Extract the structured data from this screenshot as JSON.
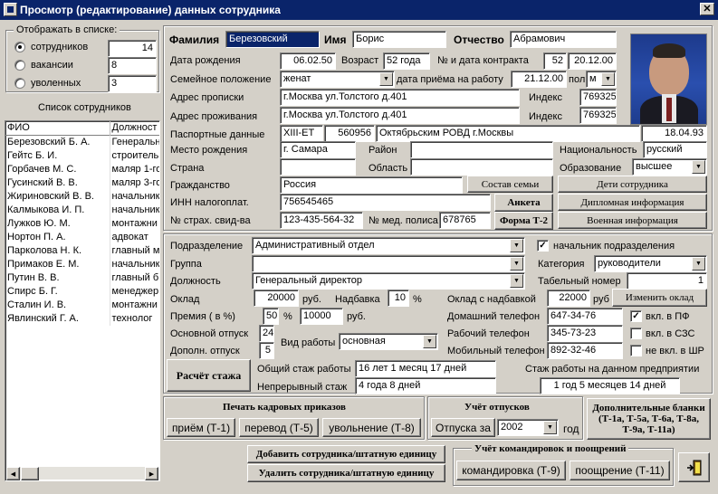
{
  "window": {
    "title": "Просмотр (редактирование) данных сотрудника",
    "close": "✕"
  },
  "left": {
    "show_title": "Отображать в списке:",
    "radios": [
      {
        "label": "сотрудников",
        "count": "14"
      },
      {
        "label": "вакансии",
        "count": "8"
      },
      {
        "label": "уволенных",
        "count": "3"
      }
    ],
    "list_title": "Список сотрудников",
    "columns": [
      "ФИО",
      "Должност"
    ],
    "rows": [
      [
        "Березовский Б. А.",
        "Генеральн"
      ],
      [
        "Гейтс Б. И.",
        "строитель"
      ],
      [
        "Горбачев М. С.",
        "маляр 1-го"
      ],
      [
        "Гусинский В. В.",
        "маляр 3-го"
      ],
      [
        "Жириновский В. В.",
        "начальник"
      ],
      [
        "Калмыкова И. П.",
        "начальник"
      ],
      [
        "Лужков Ю. М.",
        "монтажни"
      ],
      [
        "Нортон П. А.",
        "адвокат"
      ],
      [
        "Парколова Н. К.",
        "главный м"
      ],
      [
        "Примаков Е. М.",
        "начальник"
      ],
      [
        "Путин В. В.",
        "главный б"
      ],
      [
        "Спирс Б. Г.",
        "менеджер"
      ],
      [
        "Сталин И. В.",
        "монтажни"
      ],
      [
        "Явлинский Г. А.",
        "технолог"
      ]
    ]
  },
  "person": {
    "surname_label": "Фамилия",
    "surname": "Березовский",
    "name_label": "Имя",
    "name": "Борис",
    "patronymic_label": "Отчество",
    "patronymic": "Абрамович",
    "birth_label": "Дата рождения",
    "birth": "06.02.50",
    "age_label": "Возраст",
    "age": "52 года",
    "contract_label": "№ и дата контракта",
    "contract_no": "52",
    "contract_date": "20.12.00",
    "family_label": "Семейное положение",
    "family": "женат",
    "hire_label": "дата приёма на работу",
    "hire": "21.12.00",
    "sex_label": "пол",
    "sex": "м",
    "reg_label": "Адрес прописки",
    "reg": "г.Москва ул.Толстого д.401",
    "live_label": "Адрес проживания",
    "live": "г.Москва ул.Толстого д.401",
    "index_label": "Индекс",
    "index1": "769325",
    "index2": "769325",
    "passport_label": "Паспортные данные",
    "pass_series": "XIII-ЕТ",
    "pass_no": "560956",
    "pass_issuer": "Октябрьским РОВД г.Москвы",
    "pass_date": "18.04.93",
    "birthplace_label": "Место рождения",
    "birthplace": "г. Самара",
    "district_label": "Район",
    "district": "",
    "nationality_label": "Национальность",
    "nationality": "русский",
    "country_label": "Страна",
    "country": "",
    "region_label": "Область",
    "region": "",
    "education_label": "Образование",
    "education": "высшее",
    "citizenship_label": "Гражданство",
    "citizenship": "Россия",
    "inn_label": "ИНН налогоплат.",
    "inn": "756545465",
    "ins_label": "№ страх. свид-ва",
    "ins": "123-435-564-32",
    "med_label": "№ мед. полиса",
    "med": "678765"
  },
  "buttons": {
    "family": "Состав семьи",
    "anketa": "Анкета",
    "t2": "Форма Т-2",
    "children": "Дети сотрудника",
    "diploma": "Дипломная информация",
    "military": "Военная информация",
    "calc": "Расчёт стажа",
    "change_salary": "Изменить оклад"
  },
  "job": {
    "dept_label": "Подразделение",
    "dept": "Административный отдел",
    "head_label": "начальник подразделения",
    "group_label": "Группа",
    "group": "",
    "category_label": "Категория",
    "category": "руководители",
    "position_label": "Должность",
    "position": "Генеральный директор",
    "tab_label": "Табельный номер",
    "tab": "1",
    "salary_label": "Оклад",
    "salary": "20000",
    "rub": "руб.",
    "bonus_label": "Надбавка",
    "bonus": "10",
    "pct": "%",
    "salary_total_label": "Оклад с надбавкой",
    "salary_total": "22000",
    "rub2": "руб",
    "premium_label": "Премия ( в %)",
    "premium_pct": "50",
    "premium_sum": "10000",
    "home_phone_label": "Домашний телефон",
    "home_phone": "647-34-76",
    "pf_label": "вкл. в ПФ",
    "vacation_label": "Основной отпуск",
    "vacation": "24",
    "work_phone_label": "Рабочий телефон",
    "work_phone": "345-73-23",
    "szs_label": "вкл. в СЗС",
    "extra_vac_label": "Дополн. отпуск",
    "extra_vac": "5",
    "worktype_label": "Вид работы",
    "worktype": "основная",
    "mobile_label": "Мобильный телефон",
    "mobile": "892-32-46",
    "shr_label": "не вкл. в ШР",
    "total_exp_label": "Общий стаж работы",
    "total_exp": "16 лет 1 месяц 17 дней",
    "cont_exp_label": "Непрерывный стаж",
    "cont_exp": "4 года 8 дней",
    "company_exp_label": "Стаж работы на данном предприятии",
    "company_exp": "1 год 5 месяцев 14 дней"
  },
  "bottom": {
    "print_title": "Печать кадровых приказов",
    "t1": "приём (Т-1)",
    "t5": "перевод (Т-5)",
    "t8": "увольнение (Т-8)",
    "vac_title": "Учёт отпусков",
    "vac_btn": "Отпуска за",
    "year": "2002",
    "year_lbl": "год",
    "extra_forms": "Дополнительные бланки (Т-1а, Т-5а, Т-6а, Т-8а, Т-9а, Т-11а)",
    "add": "Добавить сотрудника/штатную единицу",
    "del": "Удалить сотрудника/штатную единицу",
    "trip_title": "Учёт командировок и поощрений",
    "t9": "командировка (Т-9)",
    "t11": "поощрение (Т-11)"
  }
}
